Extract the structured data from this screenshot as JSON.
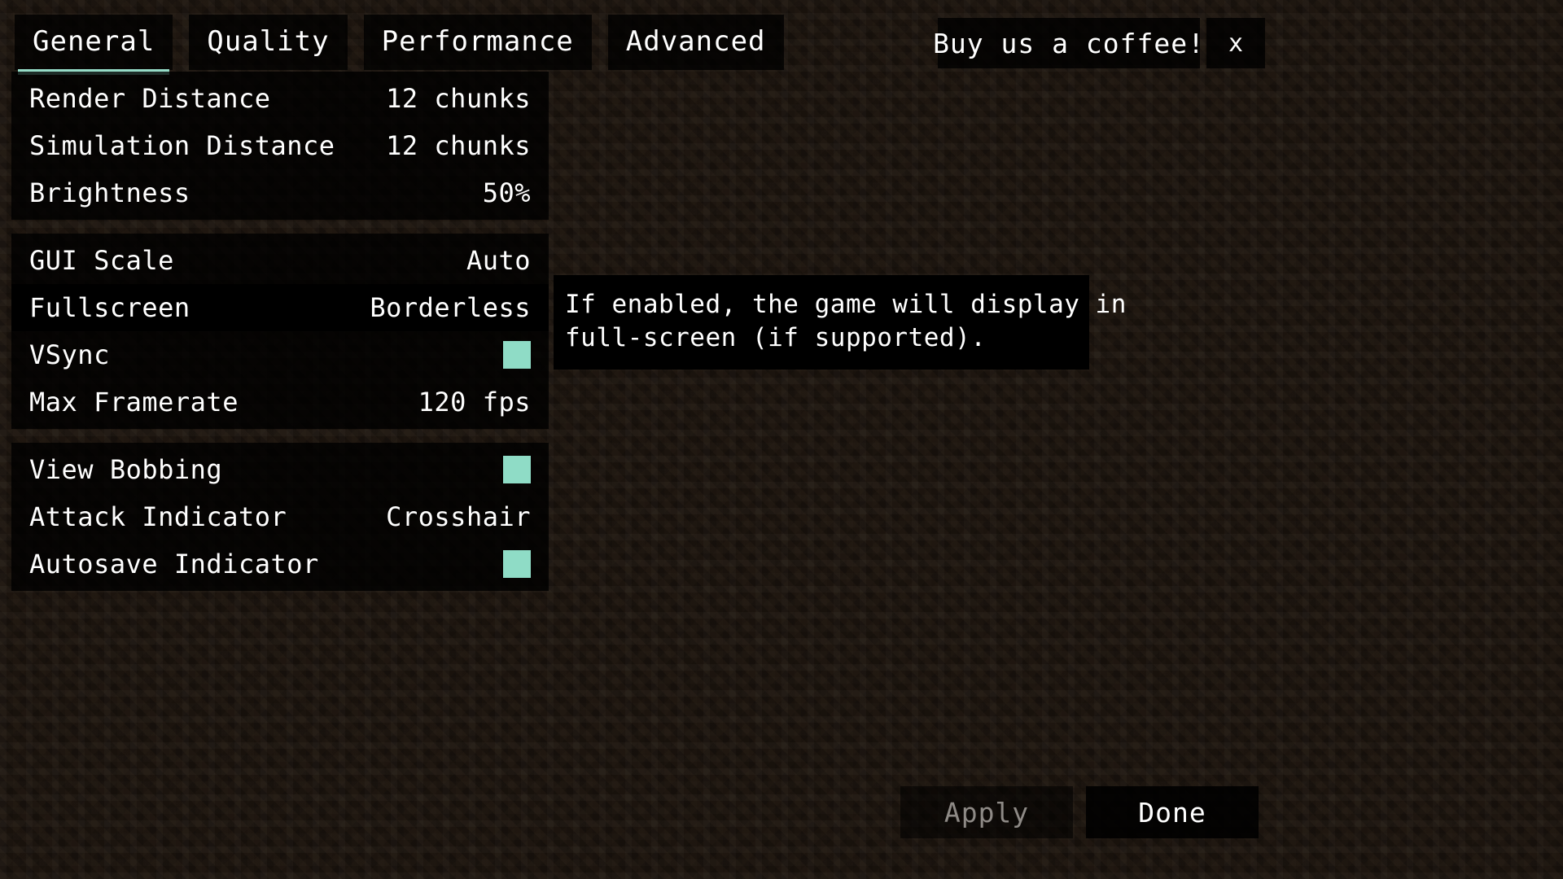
{
  "header": {
    "tabs": [
      {
        "label": "General",
        "active": true
      },
      {
        "label": "Quality",
        "active": false
      },
      {
        "label": "Performance",
        "active": false
      },
      {
        "label": "Advanced",
        "active": false
      }
    ],
    "coffee_label": "Buy us a coffee!",
    "close_label": "x"
  },
  "settings": {
    "groups": [
      {
        "rows": [
          {
            "label": "Render Distance",
            "value": "12 chunks",
            "type": "value"
          },
          {
            "label": "Simulation Distance",
            "value": "12 chunks",
            "type": "value"
          },
          {
            "label": "Brightness",
            "value": "50%",
            "type": "value"
          }
        ]
      },
      {
        "rows": [
          {
            "label": "GUI Scale",
            "value": "Auto",
            "type": "value"
          },
          {
            "label": "Fullscreen",
            "value": "Borderless",
            "type": "value",
            "highlighted": true
          },
          {
            "label": "VSync",
            "value": "on",
            "type": "checkbox",
            "checked": true
          },
          {
            "label": "Max Framerate",
            "value": "120 fps",
            "type": "value"
          }
        ]
      },
      {
        "rows": [
          {
            "label": "View Bobbing",
            "value": "on",
            "type": "checkbox",
            "checked": true
          },
          {
            "label": "Attack Indicator",
            "value": "Crosshair",
            "type": "value"
          },
          {
            "label": "Autosave Indicator",
            "value": "on",
            "type": "checkbox",
            "checked": true
          }
        ]
      }
    ]
  },
  "tooltip": {
    "line1": "If enabled, the game will display in",
    "line2": "full-screen (if supported)."
  },
  "footer": {
    "apply_label": "Apply",
    "done_label": "Done"
  },
  "colors": {
    "accent": "#8fdcc6",
    "text": "#ffffff",
    "text_disabled": "#8e8a86",
    "panel_bg": "#000000",
    "background": "#231a13"
  }
}
